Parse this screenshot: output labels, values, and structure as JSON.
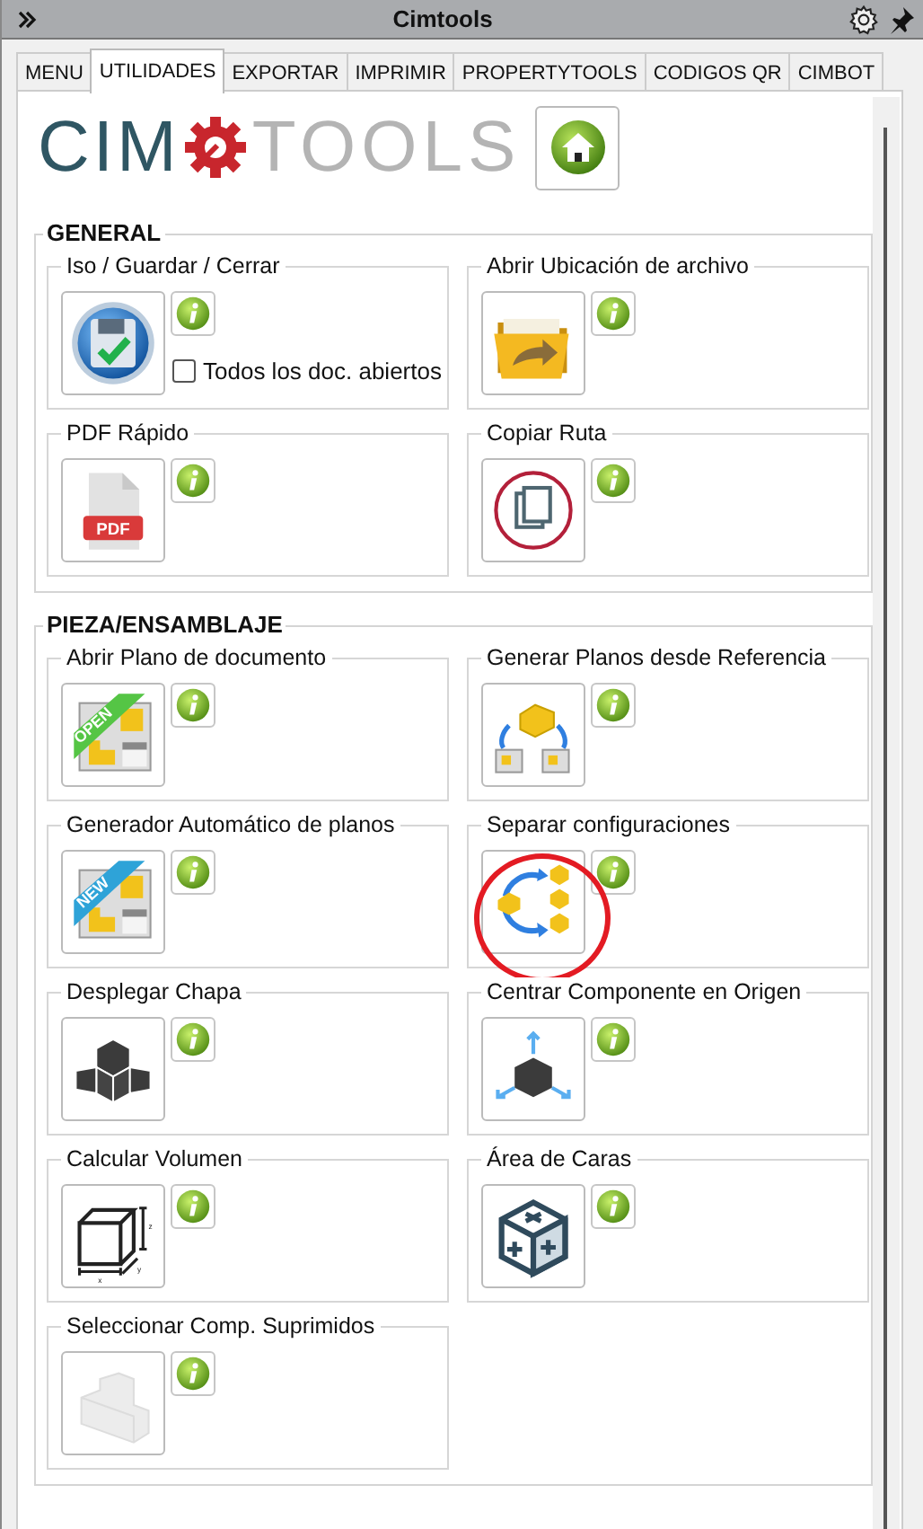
{
  "window": {
    "title": "Cimtools"
  },
  "tabs": [
    {
      "label": "MENU",
      "selected": false
    },
    {
      "label": "UTILIDADES",
      "selected": true
    },
    {
      "label": "EXPORTAR",
      "selected": false
    },
    {
      "label": "IMPRIMIR",
      "selected": false
    },
    {
      "label": "PROPERTYTOOLS",
      "selected": false
    },
    {
      "label": "CODIGOS QR",
      "selected": false
    },
    {
      "label": "CIMBOT",
      "selected": false
    }
  ],
  "logo": {
    "text_left": "CIM",
    "text_right": "TOOLS"
  },
  "sections": [
    {
      "title": "GENERAL",
      "tools": [
        {
          "label": "Iso / Guardar / Cerrar",
          "kind": "save",
          "checkbox": {
            "label": "Todos los doc. abiertos",
            "checked": false
          }
        },
        {
          "label": "Abrir Ubicación de archivo",
          "kind": "folder"
        },
        {
          "label": "PDF Rápido",
          "kind": "pdf",
          "icon_text": "PDF"
        },
        {
          "label": "Copiar Ruta",
          "kind": "copy"
        }
      ]
    },
    {
      "title": "PIEZA/ENSAMBLAJE",
      "tools": [
        {
          "label": "Abrir Plano de documento",
          "kind": "plan",
          "icon_text": "OPEN"
        },
        {
          "label": "Generar Planos desde Referencia",
          "kind": "reference"
        },
        {
          "label": "Generador Automático de planos",
          "kind": "plan",
          "icon_text": "NEW"
        },
        {
          "label": "Separar configuraciones",
          "kind": "separate",
          "circled": true
        },
        {
          "label": "Desplegar Chapa",
          "kind": "unfold"
        },
        {
          "label": "Centrar Componente en Origen",
          "kind": "center"
        },
        {
          "label": "Calcular Volumen",
          "kind": "volume",
          "axis_labels": [
            "z",
            "y",
            "x"
          ]
        },
        {
          "label": "Área de Caras",
          "kind": "faces"
        },
        {
          "label": "Seleccionar Comp. Suprimidos",
          "kind": "suppressed"
        }
      ]
    }
  ]
}
